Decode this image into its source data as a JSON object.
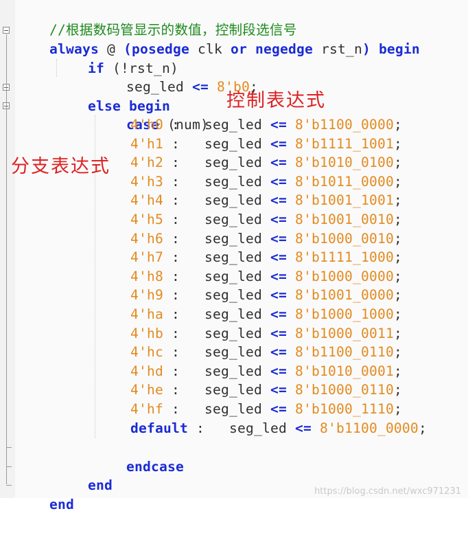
{
  "comment": "//根据数码管显示的数值，控制段选信号",
  "header": {
    "always": "always",
    "at": "@",
    "paren_open": "(",
    "posedge": "posedge",
    "clk": "clk",
    "or": "or",
    "negedge": "negedge",
    "rst_n": "rst_n",
    "paren_close": ")",
    "begin": "begin"
  },
  "if_line": {
    "if": "if",
    "cond": "(!rst_n)"
  },
  "reset_line": {
    "target": "seg_led",
    "op": "<=",
    "value": "8'b0",
    "semi": ";"
  },
  "else_line": {
    "else": "else",
    "begin": "begin"
  },
  "case_line": {
    "case": "case",
    "expr": "(num)"
  },
  "cases": [
    {
      "label": "4'h0",
      "colon": ":",
      "target": "seg_led",
      "op": "<=",
      "value": "8'b1100_0000",
      "semi": ";"
    },
    {
      "label": "4'h1",
      "colon": ":",
      "target": "seg_led",
      "op": "<=",
      "value": "8'b1111_1001",
      "semi": ";"
    },
    {
      "label": "4'h2",
      "colon": ":",
      "target": "seg_led",
      "op": "<=",
      "value": "8'b1010_0100",
      "semi": ";"
    },
    {
      "label": "4'h3",
      "colon": ":",
      "target": "seg_led",
      "op": "<=",
      "value": "8'b1011_0000",
      "semi": ";"
    },
    {
      "label": "4'h4",
      "colon": ":",
      "target": "seg_led",
      "op": "<=",
      "value": "8'b1001_1001",
      "semi": ";"
    },
    {
      "label": "4'h5",
      "colon": ":",
      "target": "seg_led",
      "op": "<=",
      "value": "8'b1001_0010",
      "semi": ";"
    },
    {
      "label": "4'h6",
      "colon": ":",
      "target": "seg_led",
      "op": "<=",
      "value": "8'b1000_0010",
      "semi": ";"
    },
    {
      "label": "4'h7",
      "colon": ":",
      "target": "seg_led",
      "op": "<=",
      "value": "8'b1111_1000",
      "semi": ";"
    },
    {
      "label": "4'h8",
      "colon": ":",
      "target": "seg_led",
      "op": "<=",
      "value": "8'b1000_0000",
      "semi": ";"
    },
    {
      "label": "4'h9",
      "colon": ":",
      "target": "seg_led",
      "op": "<=",
      "value": "8'b1001_0000",
      "semi": ";"
    },
    {
      "label": "4'ha",
      "colon": ":",
      "target": "seg_led",
      "op": "<=",
      "value": "8'b1000_1000",
      "semi": ";"
    },
    {
      "label": "4'hb",
      "colon": ":",
      "target": "seg_led",
      "op": "<=",
      "value": "8'b1000_0011",
      "semi": ";"
    },
    {
      "label": "4'hc",
      "colon": ":",
      "target": "seg_led",
      "op": "<=",
      "value": "8'b1100_0110",
      "semi": ";"
    },
    {
      "label": "4'hd",
      "colon": ":",
      "target": "seg_led",
      "op": "<=",
      "value": "8'b1010_0001",
      "semi": ";"
    },
    {
      "label": "4'he",
      "colon": ":",
      "target": "seg_led",
      "op": "<=",
      "value": "8'b1000_0110",
      "semi": ";"
    },
    {
      "label": "4'hf",
      "colon": ":",
      "target": "seg_led",
      "op": "<=",
      "value": "8'b1000_1110",
      "semi": ";"
    },
    {
      "label": "default",
      "colon": ":",
      "target": "seg_led",
      "op": "<=",
      "value": "8'b1100_0000",
      "semi": ";"
    }
  ],
  "endcase": "endcase",
  "end_inner": "end",
  "end_outer": "end",
  "annotations": {
    "control_expr": "控制表达式",
    "branch_expr": "分支表达式"
  },
  "watermark": "https://blog.csdn.net/wxc971231",
  "colors": {
    "keyword": "#1b2bd4",
    "number": "#e38a1f",
    "comment": "#1e8a1e",
    "annotation": "#dd2222"
  }
}
